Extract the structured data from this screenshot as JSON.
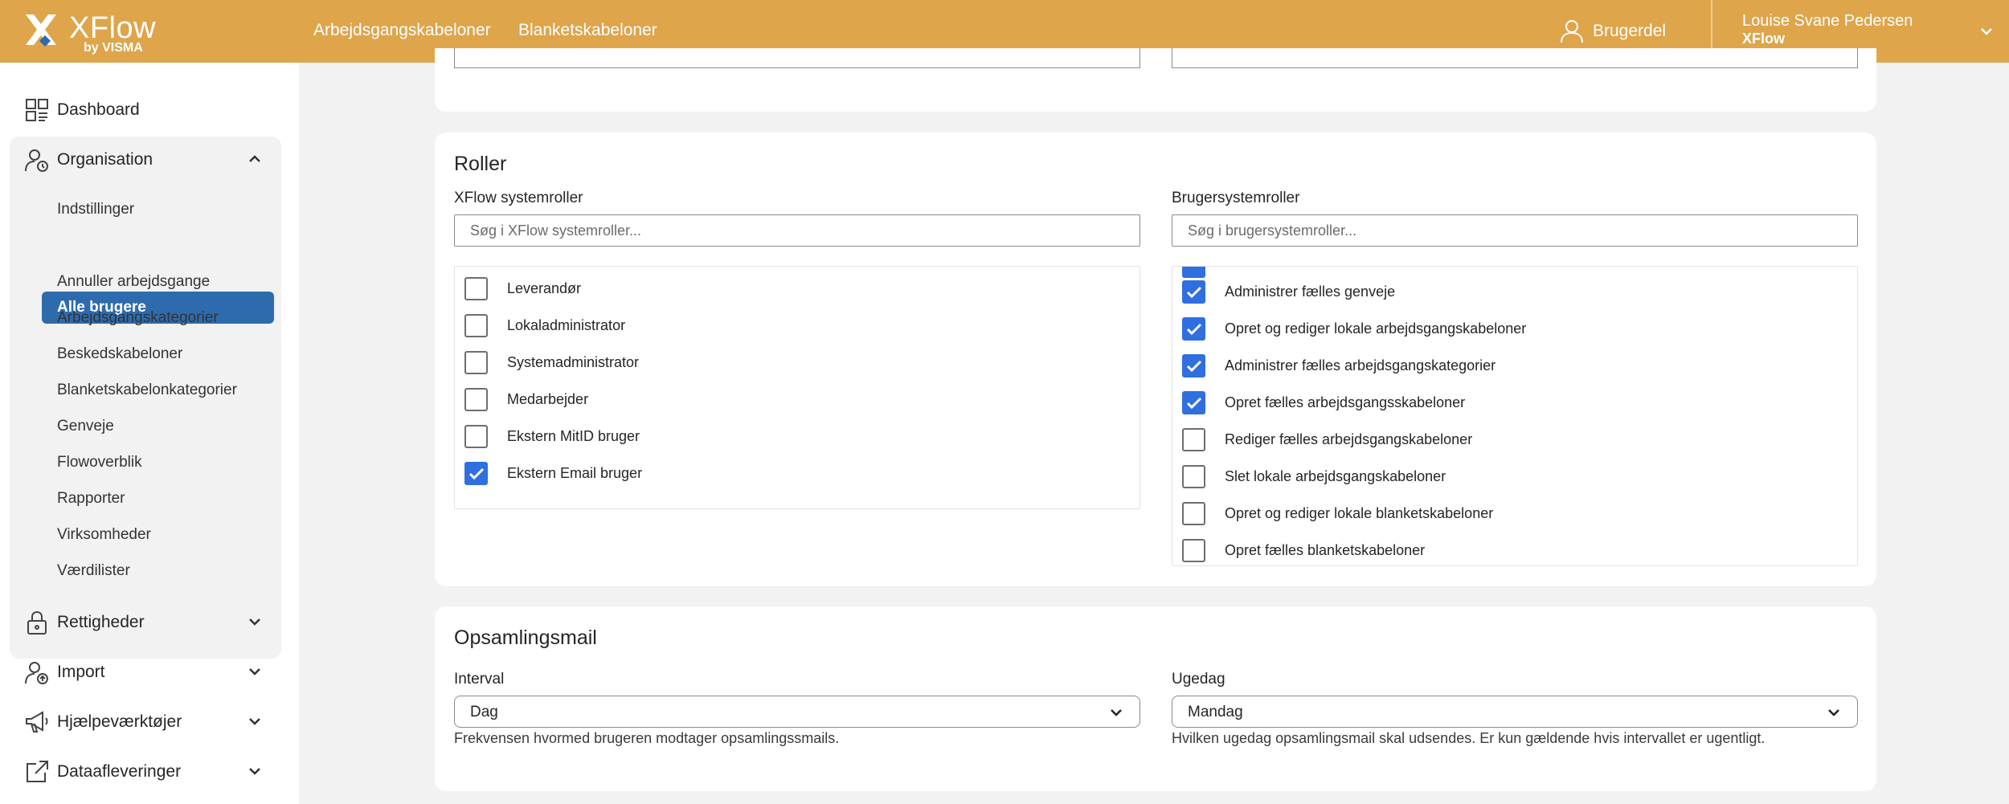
{
  "app": {
    "logo_title": "XFlow",
    "logo_sub": "by VISMA",
    "nav": [
      "Arbejdsgangskabeloner",
      "Blanketskabeloner"
    ],
    "user_part_label": "Brugerdel",
    "account_name": "Louise Svane Pedersen",
    "account_org": "XFlow",
    "colors": {
      "topbar": "#dea54b",
      "active": "#2e6bad",
      "checkbox": "#2f6fe0"
    }
  },
  "sidebar": {
    "dashboard": {
      "label": "Dashboard",
      "icon": "dashboard-icon"
    },
    "organisation": {
      "label": "Organisation",
      "icon": "organisation-icon",
      "expanded": true
    },
    "sub_items": [
      "Indstillinger",
      "Alle brugere",
      "Annuller arbejdsgange",
      "Arbejdsgangskategorier",
      "Beskedskabeloner",
      "Blanketskabelonkategorier",
      "Genveje",
      "Flowoverblik",
      "Rapporter",
      "Virksomheder",
      "Værdilister"
    ],
    "active_sub": "Alle brugere",
    "rettigheder": {
      "label": "Rettigheder",
      "icon": "lock-icon"
    },
    "import": {
      "label": "Import",
      "icon": "import-icon"
    },
    "hjaelp": {
      "label": "Hjælpeværktøjer",
      "icon": "megaphone-icon"
    },
    "data": {
      "label": "Dataafleveringer",
      "icon": "export-icon"
    }
  },
  "roles": {
    "title": "Roller",
    "xflow": {
      "label": "XFlow systemroller",
      "placeholder": "Søg i XFlow systemroller...",
      "items": [
        {
          "label": "Leverandør",
          "checked": false
        },
        {
          "label": "Lokaladministrator",
          "checked": false
        },
        {
          "label": "Systemadministrator",
          "checked": false
        },
        {
          "label": "Medarbejder",
          "checked": false
        },
        {
          "label": "Ekstern MitID bruger",
          "checked": false
        },
        {
          "label": "Ekstern Email bruger",
          "checked": true
        }
      ]
    },
    "user": {
      "label": "Brugersystemroller",
      "placeholder": "Søg i brugersystemroller...",
      "items": [
        {
          "label": "Administrer fælles genveje",
          "checked": true
        },
        {
          "label": "Opret og rediger lokale arbejdsgangskabeloner",
          "checked": true
        },
        {
          "label": "Administrer fælles arbejdsgangskategorier",
          "checked": true
        },
        {
          "label": "Opret fælles arbejdsgangsskabeloner",
          "checked": true
        },
        {
          "label": "Rediger fælles arbejdsgangskabeloner",
          "checked": false
        },
        {
          "label": "Slet lokale arbejdsgangskabeloner",
          "checked": false
        },
        {
          "label": "Opret og rediger lokale blanketskabeloner",
          "checked": false
        },
        {
          "label": "Opret fælles blanketskabeloner",
          "checked": false
        }
      ]
    }
  },
  "mail": {
    "title": "Opsamlingsmail",
    "interval": {
      "label": "Interval",
      "value": "Dag",
      "help": "Frekvensen hvormed brugeren modtager opsamlingssmails."
    },
    "weekday": {
      "label": "Ugedag",
      "value": "Mandag",
      "help": "Hvilken ugedag opsamlingsmail skal udsendes. Er kun gældende hvis intervallet er ugentligt."
    }
  }
}
